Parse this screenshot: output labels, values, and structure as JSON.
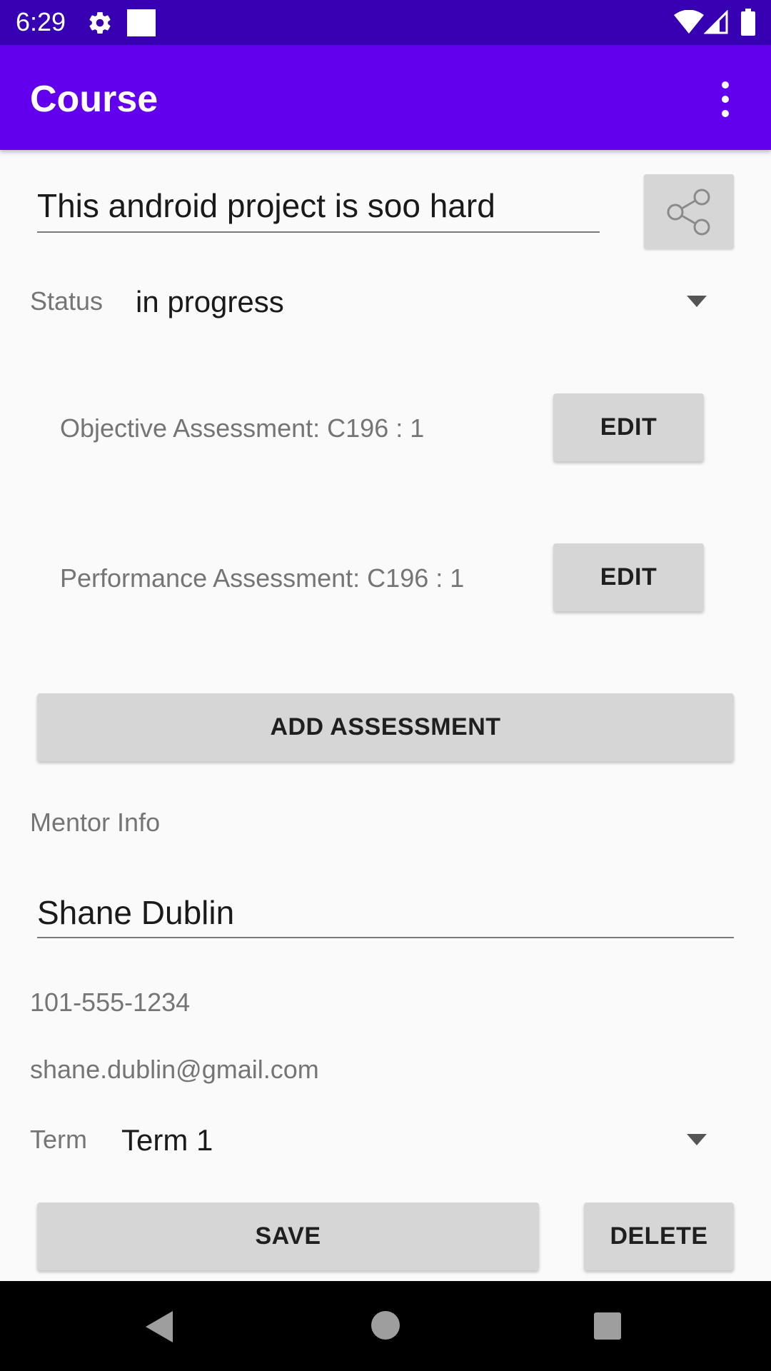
{
  "status_bar": {
    "time": "6:29",
    "icons": [
      "gear-icon",
      "square-notification-icon",
      "wifi-icon",
      "signal-icon",
      "battery-icon"
    ]
  },
  "app_bar": {
    "title": "Course",
    "menu_icon": "overflow-menu-icon",
    "background": "#6200ee",
    "status_background": "#3700b3"
  },
  "course": {
    "title_value": "This android project is soo hard",
    "share_icon": "share-icon",
    "status_label": "Status",
    "status_value": "in progress"
  },
  "assessments": [
    {
      "label": "Objective Assessment: C196 : 1",
      "button": "EDIT"
    },
    {
      "label": "Performance Assessment: C196 : 1",
      "button": "EDIT"
    }
  ],
  "add_assessment_button": "ADD ASSESSMENT",
  "mentor": {
    "section_label": "Mentor Info",
    "name_value": "Shane Dublin",
    "phone": "101-555-1234",
    "email": "shane.dublin@gmail.com"
  },
  "term": {
    "label": "Term",
    "value": "Term 1"
  },
  "actions": {
    "save": "SAVE",
    "delete": "DELETE"
  },
  "nav_bar": {
    "icons": [
      "back-icon",
      "home-icon",
      "recents-icon"
    ]
  }
}
